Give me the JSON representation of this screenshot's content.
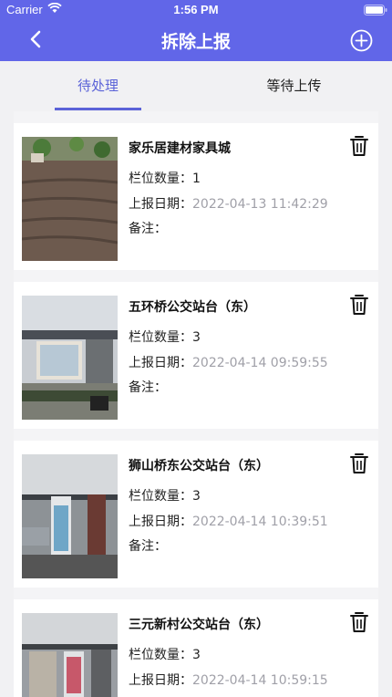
{
  "status_bar": {
    "carrier": "Carrier",
    "time": "1:56 PM"
  },
  "header": {
    "title": "拆除上报",
    "back_icon": "chevron-left-icon",
    "add_icon": "plus-circle-icon"
  },
  "tabs": [
    {
      "label": "待处理",
      "active": true
    },
    {
      "label": "等待上传",
      "active": false
    }
  ],
  "field_labels": {
    "count": "栏位数量：",
    "date": "上报日期：",
    "note": "备注："
  },
  "items": [
    {
      "name": "家乐居建材家具城",
      "count": "1",
      "date": "2022-04-13 11:42:29",
      "note": ""
    },
    {
      "name": "五环桥公交站台（东）",
      "count": "3",
      "date": "2022-04-14 09:59:55",
      "note": ""
    },
    {
      "name": "狮山桥东公交站台（东）",
      "count": "3",
      "date": "2022-04-14 10:39:51",
      "note": ""
    },
    {
      "name": "三元新村公交站台（东）",
      "count": "3",
      "date": "2022-04-14 10:59:15",
      "note": ""
    }
  ],
  "colors": {
    "header_bg": "#6166e8",
    "accent": "#5b63d8",
    "date_text": "#a0a0a8"
  }
}
